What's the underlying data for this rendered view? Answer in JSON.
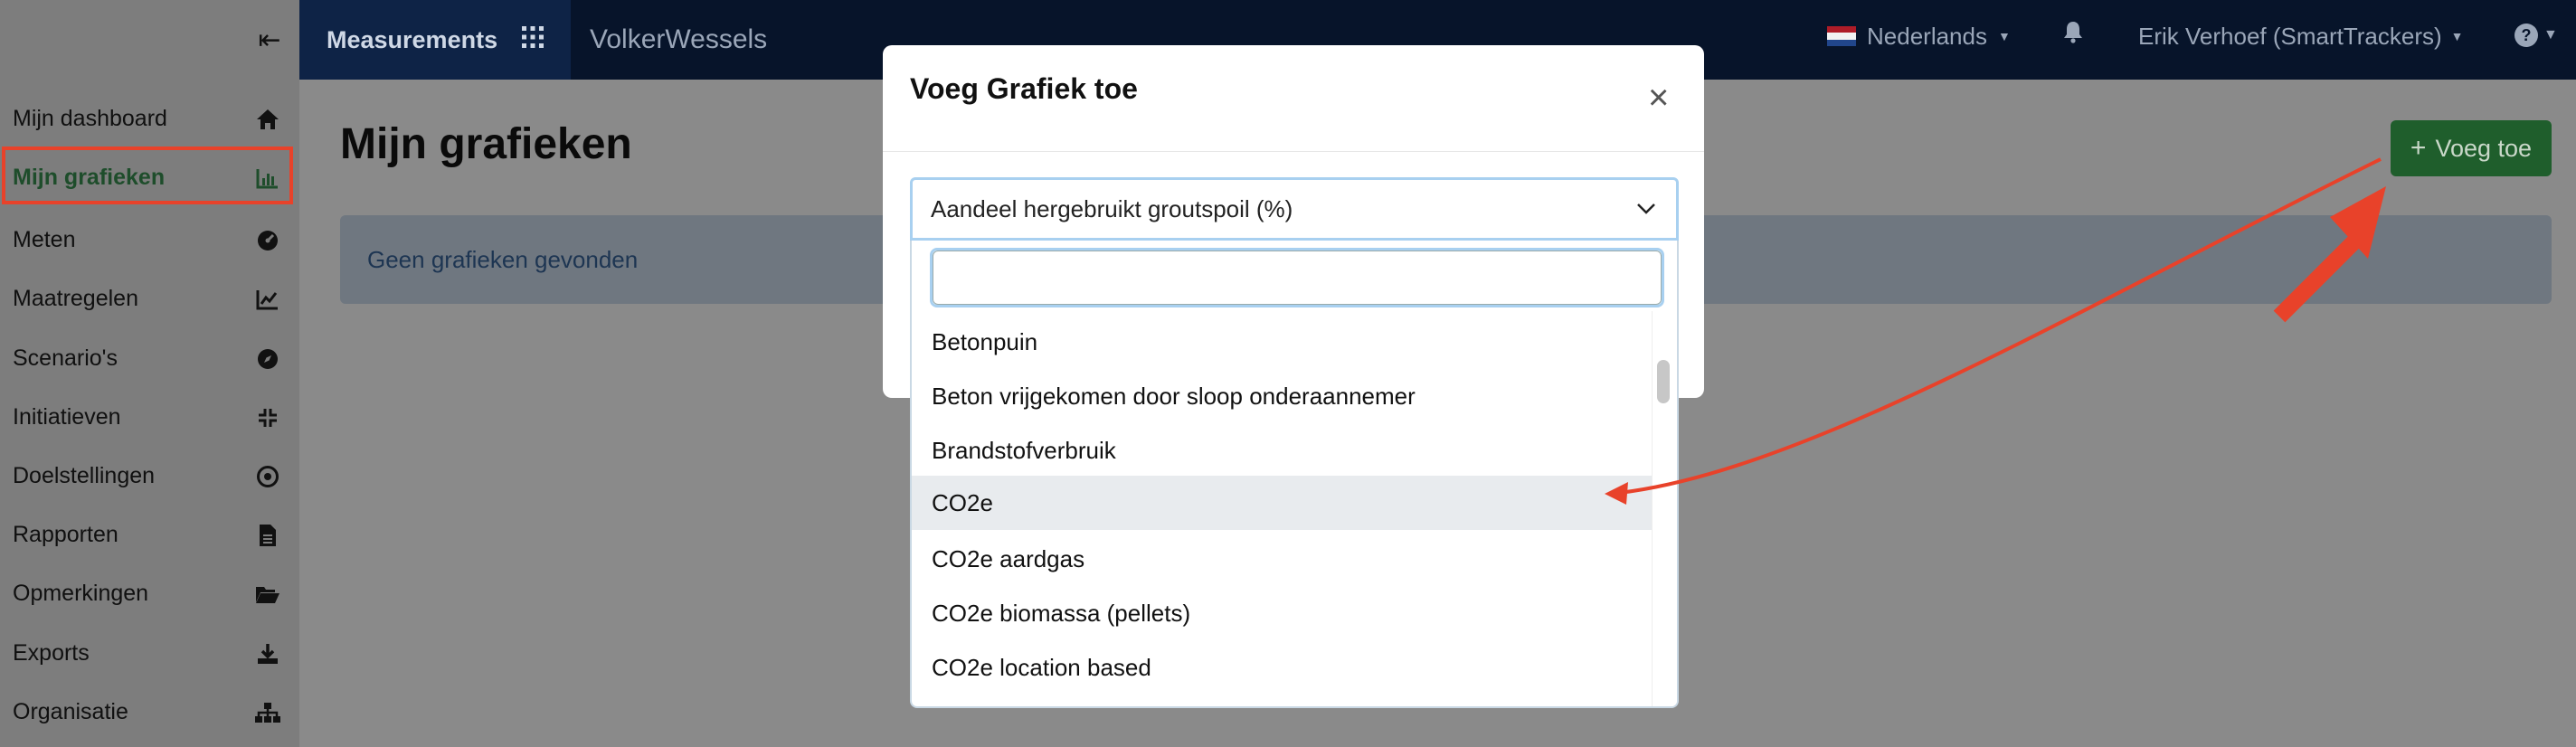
{
  "sidebar": {
    "items": [
      {
        "label": "Mijn dashboard",
        "icon": "home-icon"
      },
      {
        "label": "Mijn grafieken",
        "icon": "bar-chart-icon",
        "active": true
      },
      {
        "label": "Meten",
        "icon": "gauge-icon"
      },
      {
        "label": "Maatregelen",
        "icon": "line-chart-icon"
      },
      {
        "label": "Scenario's",
        "icon": "compass-icon"
      },
      {
        "label": "Initiatieven",
        "icon": "compress-icon"
      },
      {
        "label": "Doelstellingen",
        "icon": "target-icon"
      },
      {
        "label": "Rapporten",
        "icon": "file-icon"
      },
      {
        "label": "Opmerkingen",
        "icon": "folder-open-icon"
      },
      {
        "label": "Exports",
        "icon": "download-icon"
      },
      {
        "label": "Organisatie",
        "icon": "sitemap-icon"
      }
    ]
  },
  "topbar": {
    "brand": "Measurements",
    "company": "VolkerWessels",
    "language": "Nederlands",
    "user": "Erik Verhoef (SmartTrackers)",
    "help": "?"
  },
  "main": {
    "title": "Mijn grafieken",
    "add_button": "Voeg toe",
    "empty_message": "Geen grafieken gevonden"
  },
  "modal": {
    "title": "Voeg Grafiek toe",
    "close": "×",
    "selected_value": "Aandeel hergebruikt groutspoil (%)",
    "search_value": "",
    "options": [
      "Betonpuin",
      "Beton vrijgekomen door sloop onderaannemer",
      "Brandstofverbruik",
      "CO2e",
      "CO2e aardgas",
      "CO2e biomassa (pellets)",
      "CO2e location based"
    ],
    "hovered_option": "CO2e"
  },
  "colors": {
    "accent_green": "#1f5e2c",
    "annotation_red": "#e8422a",
    "topbar": "#07142a"
  }
}
